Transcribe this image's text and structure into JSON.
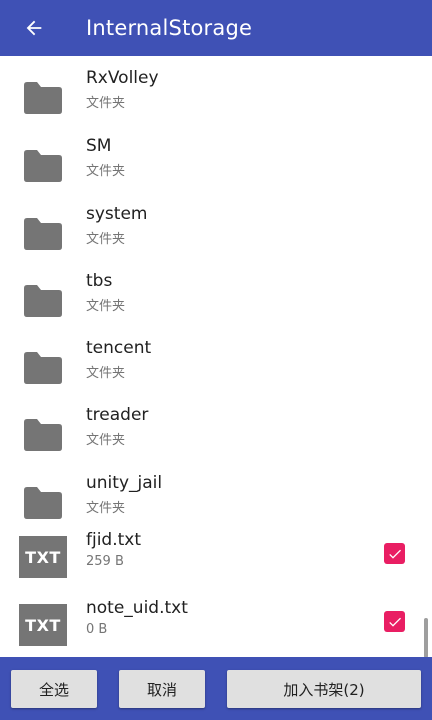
{
  "app_bar": {
    "title": "InternalStorage",
    "back_icon": "arrow-back-icon",
    "background": "#3f51b5"
  },
  "rows": [
    {
      "type": "folder",
      "name": "RxVolley",
      "sub": "文件夹",
      "icon": "folder-icon"
    },
    {
      "type": "folder",
      "name": "SM",
      "sub": "文件夹",
      "icon": "folder-icon"
    },
    {
      "type": "folder",
      "name": "system",
      "sub": "文件夹",
      "icon": "folder-icon"
    },
    {
      "type": "folder",
      "name": "tbs",
      "sub": "文件夹",
      "icon": "folder-icon"
    },
    {
      "type": "folder",
      "name": "tencent",
      "sub": "文件夹",
      "icon": "folder-icon"
    },
    {
      "type": "folder",
      "name": "treader",
      "sub": "文件夹",
      "icon": "folder-icon"
    },
    {
      "type": "folder",
      "name": "unity_jail",
      "sub": "文件夹",
      "icon": "folder-icon"
    },
    {
      "type": "file",
      "name": "fjid.txt",
      "sub": "259 B",
      "icon_label": "TXT",
      "checked": true
    },
    {
      "type": "file",
      "name": "note_uid.txt",
      "sub": "0 B",
      "icon_label": "TXT",
      "checked": true
    }
  ],
  "bottom_bar": {
    "select_all_label": "全选",
    "cancel_label": "取消",
    "add_to_shelf_label": "加入书架(2)"
  },
  "colors": {
    "primary": "#3f51b5",
    "checkbox": "#e91e63",
    "icon_gray": "#757575"
  }
}
